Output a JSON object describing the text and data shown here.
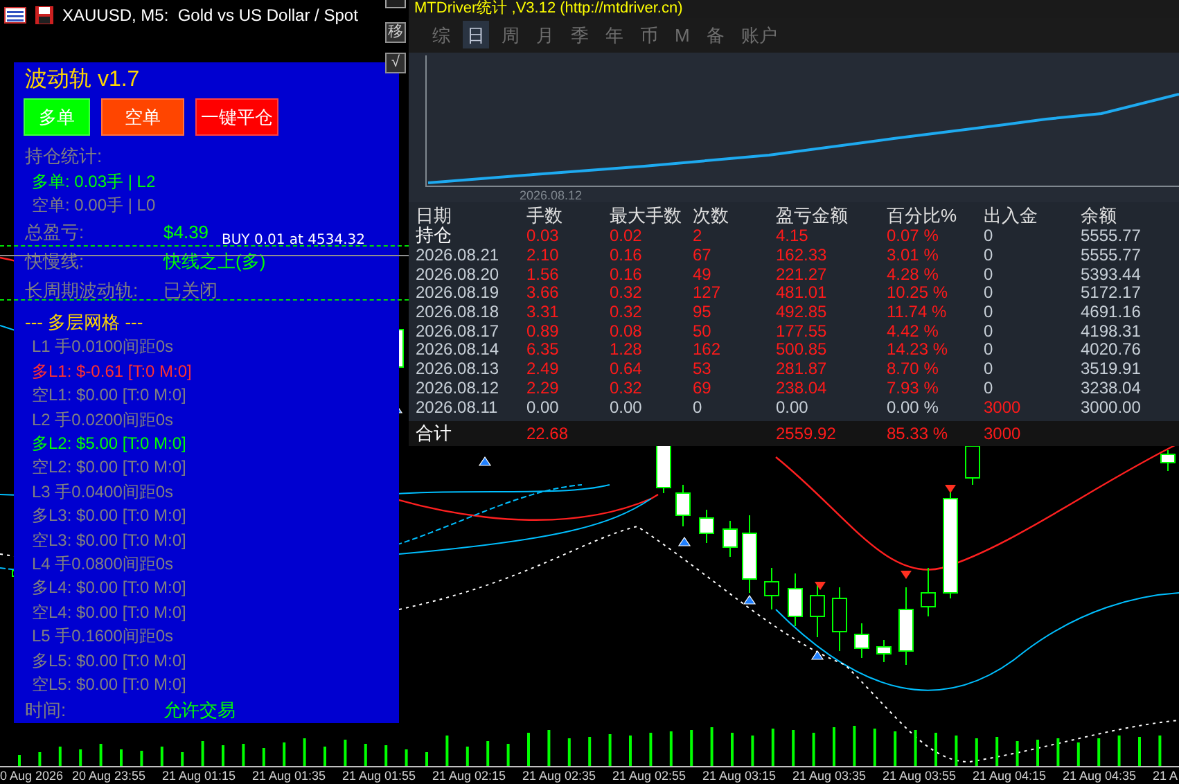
{
  "chart_window": {
    "title": "XAUUSD, M5:  Gold vs US Dollar / Spot",
    "side_buttons": [
      "移",
      "√"
    ],
    "order_lines": [
      {
        "label": "BUY 0.01 at 4534.32"
      }
    ],
    "time_axis": [
      "0 Aug 2026",
      "20 Aug 23:55",
      "21 Aug 01:15",
      "21 Aug 01:35",
      "21 Aug 01:55",
      "21 Aug 02:15",
      "21 Aug 02:35",
      "21 Aug 02:55",
      "21 Aug 03:15",
      "21 Aug 03:35",
      "21 Aug 03:55",
      "21 Aug 04:15",
      "21 Aug 04:35",
      "21 A"
    ]
  },
  "panel": {
    "title": "波动轨 v1.7",
    "buttons": [
      {
        "label": "多单",
        "color": "#00ff00"
      },
      {
        "label": "空单",
        "color": "#ff4500"
      },
      {
        "label": "一键平仓",
        "color": "#ff0000"
      }
    ],
    "rows": [
      {
        "kind": "heading",
        "text": "持仓统计:",
        "color": "#808080"
      },
      {
        "kind": "item",
        "text": "多单: 0.03手 | L2",
        "color": "#00ff00"
      },
      {
        "kind": "item",
        "text": "空单: 0.00手 | L0",
        "color": "#808080"
      },
      {
        "kind": "pair",
        "text": "总盈亏:",
        "color": "#808080",
        "value": {
          "text": "$4.39",
          "color": "#00ff00"
        }
      },
      {
        "kind": "pair",
        "text": "快慢线:",
        "color": "#808080",
        "value": {
          "text": "快线之上(多)",
          "color": "#00ff00"
        }
      },
      {
        "kind": "pair",
        "text": "长周期波动轨:",
        "color": "#808080",
        "value": {
          "text": "已关闭",
          "color": "#808080"
        }
      },
      {
        "kind": "heading",
        "text": "--- 多层网格 ---",
        "color": "#ffd700"
      },
      {
        "kind": "item",
        "text": "L1 手0.0100间距0s",
        "color": "#808080"
      },
      {
        "kind": "item",
        "text": "多L1: $-0.61 [T:0 M:0]",
        "color": "#ff3030"
      },
      {
        "kind": "item",
        "text": "空L1: $0.00 [T:0 M:0]",
        "color": "#808080"
      },
      {
        "kind": "item",
        "text": "L2 手0.0200间距0s",
        "color": "#808080"
      },
      {
        "kind": "item",
        "text": "多L2: $5.00 [T:0 M:0]",
        "color": "#00ff00"
      },
      {
        "kind": "item",
        "text": "空L2: $0.00 [T:0 M:0]",
        "color": "#808080"
      },
      {
        "kind": "item",
        "text": "L3 手0.0400间距0s",
        "color": "#808080"
      },
      {
        "kind": "item",
        "text": "多L3: $0.00 [T:0 M:0]",
        "color": "#808080"
      },
      {
        "kind": "item",
        "text": "空L3: $0.00 [T:0 M:0]",
        "color": "#808080"
      },
      {
        "kind": "item",
        "text": "L4 手0.0800间距0s",
        "color": "#808080"
      },
      {
        "kind": "item",
        "text": "多L4: $0.00 [T:0 M:0]",
        "color": "#808080"
      },
      {
        "kind": "item",
        "text": "空L4: $0.00 [T:0 M:0]",
        "color": "#808080"
      },
      {
        "kind": "item",
        "text": "L5 手0.1600间距0s",
        "color": "#808080"
      },
      {
        "kind": "item",
        "text": "多L5: $0.00 [T:0 M:0]",
        "color": "#808080"
      },
      {
        "kind": "item",
        "text": "空L5: $0.00 [T:0 M:0]",
        "color": "#808080"
      },
      {
        "kind": "pair",
        "text": "时间:",
        "color": "#808080",
        "value": {
          "text": "允许交易",
          "color": "#00ff00"
        }
      }
    ]
  },
  "stats": {
    "title": "MTDriver统计 ,V3.12 (http://mtdriver.cn)",
    "tabs": [
      {
        "label": "综",
        "selected": false
      },
      {
        "label": "日",
        "selected": true
      },
      {
        "label": "周",
        "selected": false
      },
      {
        "label": "月",
        "selected": false
      },
      {
        "label": "季",
        "selected": false
      },
      {
        "label": "年",
        "selected": false
      },
      {
        "label": "币",
        "selected": false
      },
      {
        "label": "M",
        "selected": false
      },
      {
        "label": "备",
        "selected": false
      },
      {
        "label": "账户",
        "selected": false
      }
    ],
    "chart_date": "2026.08.12",
    "columns": [
      "日期",
      "手数",
      "最大手数",
      "次数",
      "盈亏金额",
      "百分比%",
      "出入金",
      "余额"
    ],
    "rows": [
      {
        "cells": [
          {
            "text": "持仓",
            "color": "#ffffff"
          },
          {
            "text": "0.03",
            "color": "#ff1a1a"
          },
          {
            "text": "0.02",
            "color": "#ff1a1a"
          },
          {
            "text": "2",
            "color": "#ff1a1a"
          },
          {
            "text": "4.15",
            "color": "#ff1a1a"
          },
          {
            "text": "0.07 %",
            "color": "#ff1a1a"
          },
          {
            "text": "0",
            "color": "#c8d0d8"
          },
          {
            "text": "5555.77",
            "color": "#c8d0d8"
          }
        ]
      },
      {
        "cells": [
          {
            "text": "2026.08.21",
            "color": "#c8d0d8"
          },
          {
            "text": "2.10",
            "color": "#ff1a1a"
          },
          {
            "text": "0.16",
            "color": "#ff1a1a"
          },
          {
            "text": "67",
            "color": "#ff1a1a"
          },
          {
            "text": "162.33",
            "color": "#ff1a1a"
          },
          {
            "text": "3.01 %",
            "color": "#ff1a1a"
          },
          {
            "text": "0",
            "color": "#c8d0d8"
          },
          {
            "text": "5555.77",
            "color": "#c8d0d8"
          }
        ]
      },
      {
        "cells": [
          {
            "text": "2026.08.20",
            "color": "#c8d0d8"
          },
          {
            "text": "1.56",
            "color": "#ff1a1a"
          },
          {
            "text": "0.16",
            "color": "#ff1a1a"
          },
          {
            "text": "49",
            "color": "#ff1a1a"
          },
          {
            "text": "221.27",
            "color": "#ff1a1a"
          },
          {
            "text": "4.28 %",
            "color": "#ff1a1a"
          },
          {
            "text": "0",
            "color": "#c8d0d8"
          },
          {
            "text": "5393.44",
            "color": "#c8d0d8"
          }
        ]
      },
      {
        "cells": [
          {
            "text": "2026.08.19",
            "color": "#c8d0d8"
          },
          {
            "text": "3.66",
            "color": "#ff1a1a"
          },
          {
            "text": "0.32",
            "color": "#ff1a1a"
          },
          {
            "text": "127",
            "color": "#ff1a1a"
          },
          {
            "text": "481.01",
            "color": "#ff1a1a"
          },
          {
            "text": "10.25 %",
            "color": "#ff1a1a"
          },
          {
            "text": "0",
            "color": "#c8d0d8"
          },
          {
            "text": "5172.17",
            "color": "#c8d0d8"
          }
        ]
      },
      {
        "cells": [
          {
            "text": "2026.08.18",
            "color": "#c8d0d8"
          },
          {
            "text": "3.31",
            "color": "#ff1a1a"
          },
          {
            "text": "0.32",
            "color": "#ff1a1a"
          },
          {
            "text": "95",
            "color": "#ff1a1a"
          },
          {
            "text": "492.85",
            "color": "#ff1a1a"
          },
          {
            "text": "11.74 %",
            "color": "#ff1a1a"
          },
          {
            "text": "0",
            "color": "#c8d0d8"
          },
          {
            "text": "4691.16",
            "color": "#c8d0d8"
          }
        ]
      },
      {
        "cells": [
          {
            "text": "2026.08.17",
            "color": "#c8d0d8"
          },
          {
            "text": "0.89",
            "color": "#ff1a1a"
          },
          {
            "text": "0.08",
            "color": "#ff1a1a"
          },
          {
            "text": "50",
            "color": "#ff1a1a"
          },
          {
            "text": "177.55",
            "color": "#ff1a1a"
          },
          {
            "text": "4.42 %",
            "color": "#ff1a1a"
          },
          {
            "text": "0",
            "color": "#c8d0d8"
          },
          {
            "text": "4198.31",
            "color": "#c8d0d8"
          }
        ]
      },
      {
        "cells": [
          {
            "text": "2026.08.14",
            "color": "#c8d0d8"
          },
          {
            "text": "6.35",
            "color": "#ff1a1a"
          },
          {
            "text": "1.28",
            "color": "#ff1a1a"
          },
          {
            "text": "162",
            "color": "#ff1a1a"
          },
          {
            "text": "500.85",
            "color": "#ff1a1a"
          },
          {
            "text": "14.23 %",
            "color": "#ff1a1a"
          },
          {
            "text": "0",
            "color": "#c8d0d8"
          },
          {
            "text": "4020.76",
            "color": "#c8d0d8"
          }
        ]
      },
      {
        "cells": [
          {
            "text": "2026.08.13",
            "color": "#c8d0d8"
          },
          {
            "text": "2.49",
            "color": "#ff1a1a"
          },
          {
            "text": "0.64",
            "color": "#ff1a1a"
          },
          {
            "text": "53",
            "color": "#ff1a1a"
          },
          {
            "text": "281.87",
            "color": "#ff1a1a"
          },
          {
            "text": "8.70 %",
            "color": "#ff1a1a"
          },
          {
            "text": "0",
            "color": "#c8d0d8"
          },
          {
            "text": "3519.91",
            "color": "#c8d0d8"
          }
        ]
      },
      {
        "cells": [
          {
            "text": "2026.08.12",
            "color": "#c8d0d8"
          },
          {
            "text": "2.29",
            "color": "#ff1a1a"
          },
          {
            "text": "0.32",
            "color": "#ff1a1a"
          },
          {
            "text": "69",
            "color": "#ff1a1a"
          },
          {
            "text": "238.04",
            "color": "#ff1a1a"
          },
          {
            "text": "7.93 %",
            "color": "#ff1a1a"
          },
          {
            "text": "0",
            "color": "#c8d0d8"
          },
          {
            "text": "3238.04",
            "color": "#c8d0d8"
          }
        ]
      },
      {
        "cells": [
          {
            "text": "2026.08.11",
            "color": "#c8d0d8"
          },
          {
            "text": "0.00",
            "color": "#c8d0d8"
          },
          {
            "text": "0.00",
            "color": "#c8d0d8"
          },
          {
            "text": "0",
            "color": "#c8d0d8"
          },
          {
            "text": "0.00",
            "color": "#c8d0d8"
          },
          {
            "text": "0.00 %",
            "color": "#c8d0d8"
          },
          {
            "text": "3000",
            "color": "#ff1a1a"
          },
          {
            "text": "3000.00",
            "color": "#c8d0d8"
          }
        ]
      }
    ],
    "total": {
      "label": {
        "text": "合计",
        "color": "#ffffff"
      },
      "lots": {
        "text": "22.68",
        "color": "#ff1a1a"
      },
      "pnl": {
        "text": "2559.92",
        "color": "#ff1a1a"
      },
      "percent": {
        "text": "85.33 %",
        "color": "#ff1a1a"
      },
      "deposit": {
        "text": "3000",
        "color": "#ff1a1a"
      }
    }
  }
}
